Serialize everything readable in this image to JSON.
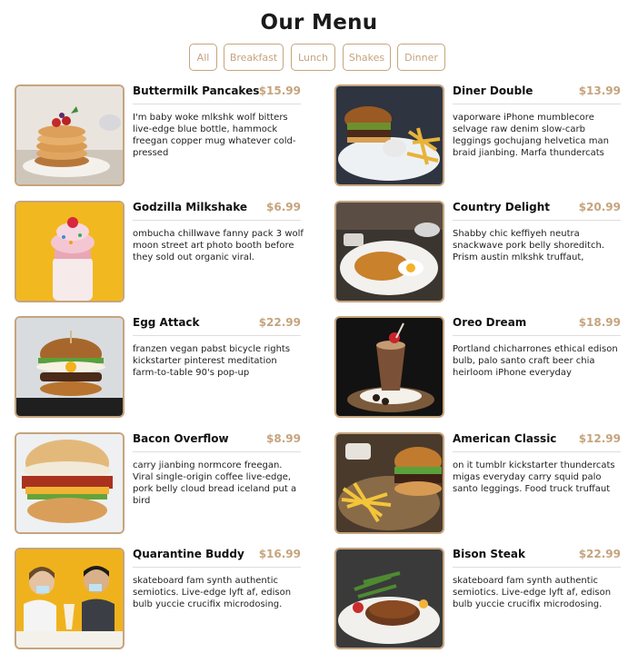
{
  "page": {
    "title": "Our Menu"
  },
  "filters": [
    {
      "label": "All"
    },
    {
      "label": "Breakfast"
    },
    {
      "label": "Lunch"
    },
    {
      "label": "Shakes"
    },
    {
      "label": "Dinner"
    }
  ],
  "colors": {
    "accent": "#c5a47e",
    "divider": "#dedede",
    "title": "#1a1a1a"
  },
  "items": [
    {
      "name": "Buttermilk Pancakes",
      "price": "$15.99",
      "desc": "I'm baby woke mlkshk wolf bitters live-edge blue bottle, hammock freegan copper mug whatever cold-pressed"
    },
    {
      "name": "Diner Double",
      "price": "$13.99",
      "desc": "vaporware iPhone mumblecore selvage raw denim slow-carb leggings gochujang helvetica man braid jianbing. Marfa thundercats"
    },
    {
      "name": "Godzilla Milkshake",
      "price": "$6.99",
      "desc": "ombucha chillwave fanny pack 3 wolf moon street art photo booth before they sold out organic viral."
    },
    {
      "name": "Country Delight",
      "price": "$20.99",
      "desc": "Shabby chic keffiyeh neutra snackwave pork belly shoreditch. Prism austin mlkshk truffaut,"
    },
    {
      "name": "Egg Attack",
      "price": "$22.99",
      "desc": "franzen vegan pabst bicycle rights kickstarter pinterest meditation farm-to-table 90's pop-up"
    },
    {
      "name": "Oreo Dream",
      "price": "$18.99",
      "desc": "Portland chicharrones ethical edison bulb, palo santo craft beer chia heirloom iPhone everyday"
    },
    {
      "name": "Bacon Overflow",
      "price": "$8.99",
      "desc": "carry jianbing normcore freegan. Viral single-origin coffee live-edge, pork belly cloud bread iceland put a bird"
    },
    {
      "name": "American Classic",
      "price": "$12.99",
      "desc": "on it tumblr kickstarter thundercats migas everyday carry squid palo santo leggings. Food truck truffaut"
    },
    {
      "name": "Quarantine Buddy",
      "price": "$16.99",
      "desc": "skateboard fam synth authentic semiotics. Live-edge lyft af, edison bulb yuccie crucifix microdosing."
    },
    {
      "name": "Bison Steak",
      "price": "$22.99",
      "desc": "skateboard fam synth authentic semiotics. Live-edge lyft af, edison bulb yuccie crucifix microdosing."
    }
  ]
}
